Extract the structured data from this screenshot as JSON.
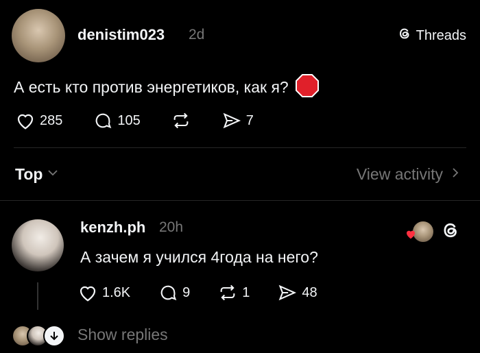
{
  "post": {
    "username": "denistim023",
    "time": "2d",
    "brand": "Threads",
    "text": "А есть кто против энергетиков, как я?",
    "likes": "285",
    "comments": "105",
    "shares": "7"
  },
  "filter": {
    "sort_label": "Top",
    "view_activity": "View activity"
  },
  "reply": {
    "username": "kenzh.ph",
    "time": "20h",
    "text": "А зачем я учился 4года на него?",
    "likes": "1.6K",
    "comments": "9",
    "reposts": "1",
    "shares": "48"
  },
  "replies_footer": {
    "show_replies": "Show replies"
  },
  "colors": {
    "background": "#000000",
    "text": "#f3f5f7",
    "muted": "#777777",
    "heart": "#ff3040",
    "stop": "#e0202a"
  }
}
